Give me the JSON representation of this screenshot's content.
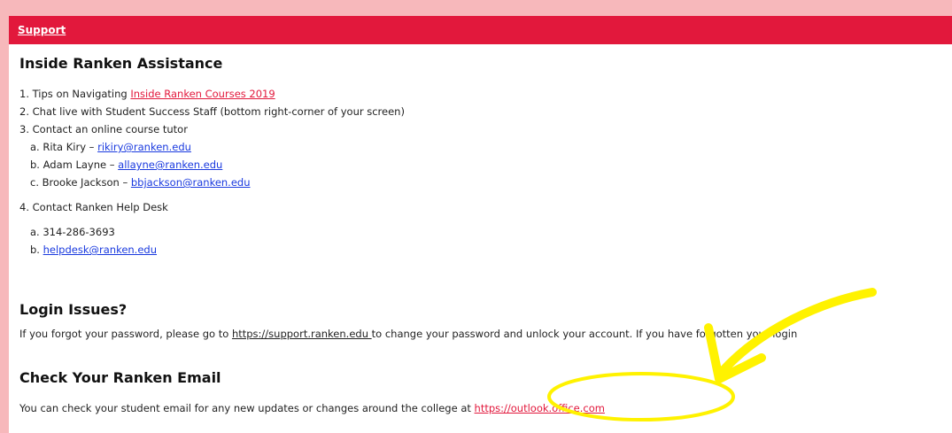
{
  "header": {
    "link_label": "Support"
  },
  "assistance": {
    "title": "Inside Ranken Assistance",
    "item1_prefix": "1. Tips on Navigating ",
    "item1_link": "Inside Ranken Courses 2019",
    "item2": "2. Chat live with Student Success Staff (bottom right-corner of your screen)",
    "item3": "3. Contact an online course tutor",
    "tutors": [
      {
        "prefix": "a. Rita Kiry – ",
        "email": "rikiry@ranken.edu"
      },
      {
        "prefix": "b. Adam Layne – ",
        "email": "allayne@ranken.edu"
      },
      {
        "prefix": "c. Brooke Jackson – ",
        "email": "bbjackson@ranken.edu"
      }
    ],
    "item4": "4. Contact Ranken Help Desk",
    "helpdesk_phone": "a. 314-286-3693",
    "helpdesk_email_prefix": "b. ",
    "helpdesk_email": "helpdesk@ranken.edu"
  },
  "login": {
    "title": "Login Issues?",
    "text_prefix": "If you forgot your password, please go to ",
    "link": "https://support.ranken.edu ",
    "text_suffix": " to change your password and unlock your account. If you have forgotten your login"
  },
  "email": {
    "title": "Check Your Ranken Email",
    "text_prefix": "You can check your student email for any new updates or changes around the college at ",
    "link": "https://outlook.office.com"
  },
  "colors": {
    "brand_red": "#e2183c",
    "highlight_yellow": "#fff200",
    "border_pink": "#f7b8bb"
  }
}
